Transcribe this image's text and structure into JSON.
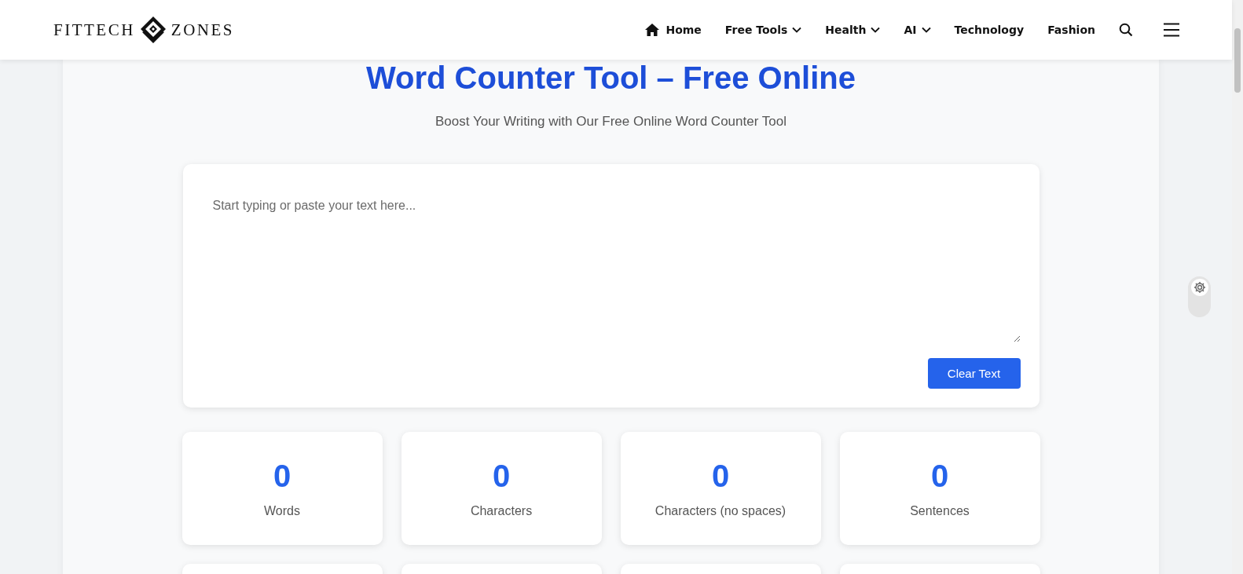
{
  "header": {
    "logo": {
      "left": "FITTECH",
      "right": "ZONES"
    },
    "nav": [
      {
        "label": "Home",
        "kind": "home"
      },
      {
        "label": "Free Tools",
        "kind": "dropdown"
      },
      {
        "label": "Health",
        "kind": "dropdown"
      },
      {
        "label": "AI",
        "kind": "dropdown"
      },
      {
        "label": "Technology",
        "kind": "link"
      },
      {
        "label": "Fashion",
        "kind": "link"
      }
    ]
  },
  "tool": {
    "title": "Word Counter Tool – Free Online",
    "subtitle": "Boost Your Writing with Our Free Online Word Counter Tool",
    "text_area": {
      "placeholder": "Start typing or paste your text here..."
    },
    "clear_button": "Clear Text",
    "stats": [
      {
        "value": "0",
        "label": "Words"
      },
      {
        "value": "0",
        "label": "Characters"
      },
      {
        "value": "0",
        "label": "Characters (no spaces)"
      },
      {
        "value": "0",
        "label": "Sentences"
      }
    ]
  }
}
